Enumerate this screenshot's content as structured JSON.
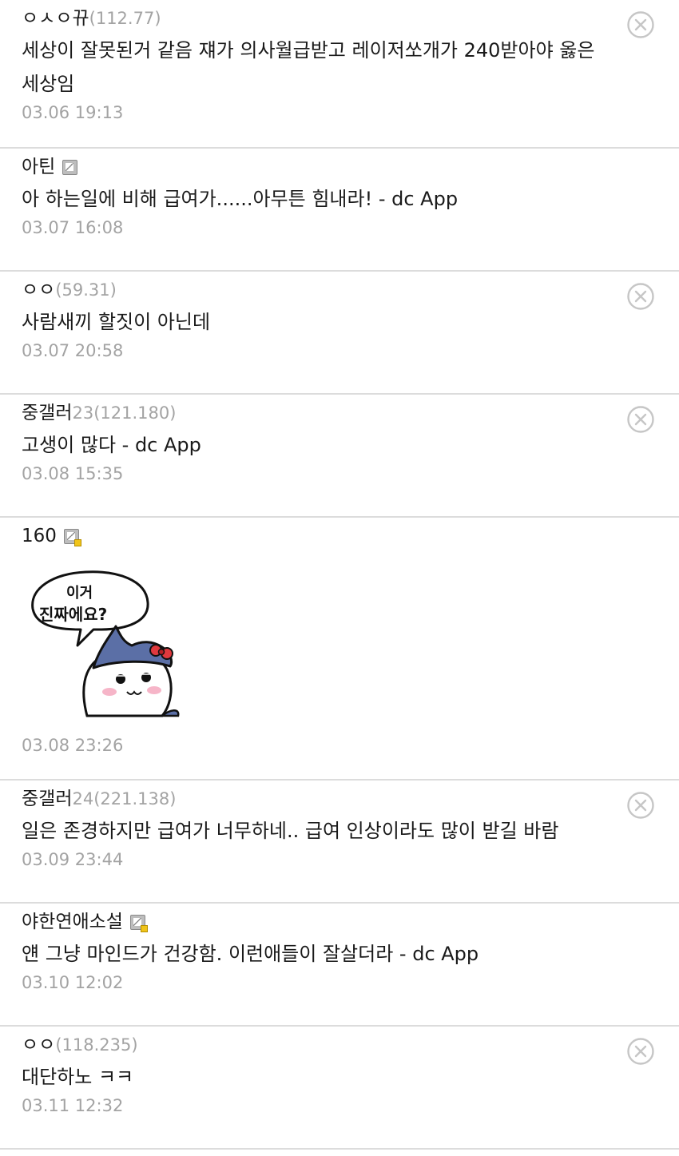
{
  "comments": [
    {
      "nick": "ㅇㅅㅇ뀨",
      "ip": "(112.77)",
      "text": "세상이 잘못된거 같음 쟤가 의사월급받고 레이저쏘개가 240받아야 옳은 세상임",
      "date": "03.06 19:13"
    },
    {
      "nick": "아틴",
      "text": "아 하는일에 비해 급여가......아무튼 힘내라! - dc App",
      "date": "03.07 16:08"
    },
    {
      "nick": "ㅇㅇ",
      "ip": "(59.31)",
      "text": "사람새끼 할짓이 아닌데",
      "date": "03.07 20:58"
    },
    {
      "nick": "중갤러",
      "num": "23",
      "ip": "(121.180)",
      "text": "고생이 많다 - dc App",
      "date": "03.08 15:35"
    },
    {
      "nick": "160",
      "date": "03.08 23:26",
      "sticker_text": [
        "이거",
        "진짜에요?"
      ]
    },
    {
      "nick": "중갤러",
      "num": "24",
      "ip": "(221.138)",
      "text": "일은 존경하지만 급여가 너무하네.. 급여 인상이라도 많이 받길 바람",
      "date": "03.09 23:44"
    },
    {
      "nick": "야한연애소설",
      "text": "얜 그냥 마인드가 건강함. 이런애들이 잘살더라 - dc App",
      "date": "03.10 12:02"
    },
    {
      "nick": "ㅇㅇ",
      "ip": "(118.235)",
      "text": "대단하노 ㅋㅋ",
      "date": "03.11 12:32"
    }
  ],
  "icons": {
    "delete": "close-circle-icon",
    "member": "gallery-member-icon"
  },
  "colors": {
    "meta": "#a3a3a3",
    "divider": "#dcdcdc",
    "text": "#1a1a1a",
    "sticker_body": "#ffffff",
    "sticker_hat": "#5b6fa6",
    "sticker_bow": "#e0393e"
  }
}
